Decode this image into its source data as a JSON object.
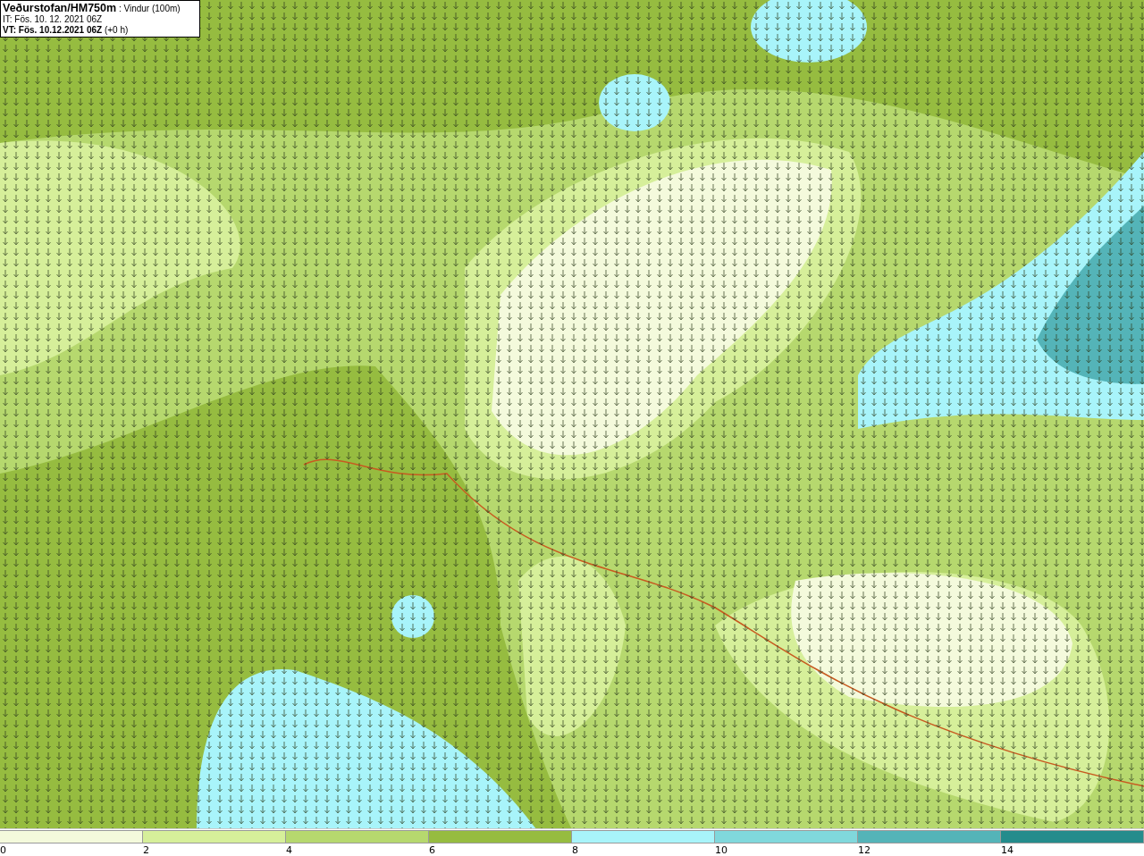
{
  "header": {
    "title_line": "**Veðurstofan/HM750m** : Vindur (100m)",
    "issue_time": "IT: Fös. 10. 12. 2021 06Z",
    "valid_time": "**VT: Fös. 10.12.2021 06Z** (+0 h)"
  },
  "legend": [
    {
      "label": "0",
      "color": "#f4fadc"
    },
    {
      "label": "2",
      "color": "#d6ef9a"
    },
    {
      "label": "4",
      "color": "#b6d86e"
    },
    {
      "label": "6",
      "color": "#96bc40"
    },
    {
      "label": "8",
      "color": "#a8f4fa"
    },
    {
      "label": "10",
      "color": "#80d8dc"
    },
    {
      "label": "12",
      "color": "#54b4b8"
    },
    {
      "label": "14",
      "color": "#248c8c"
    }
  ]
}
